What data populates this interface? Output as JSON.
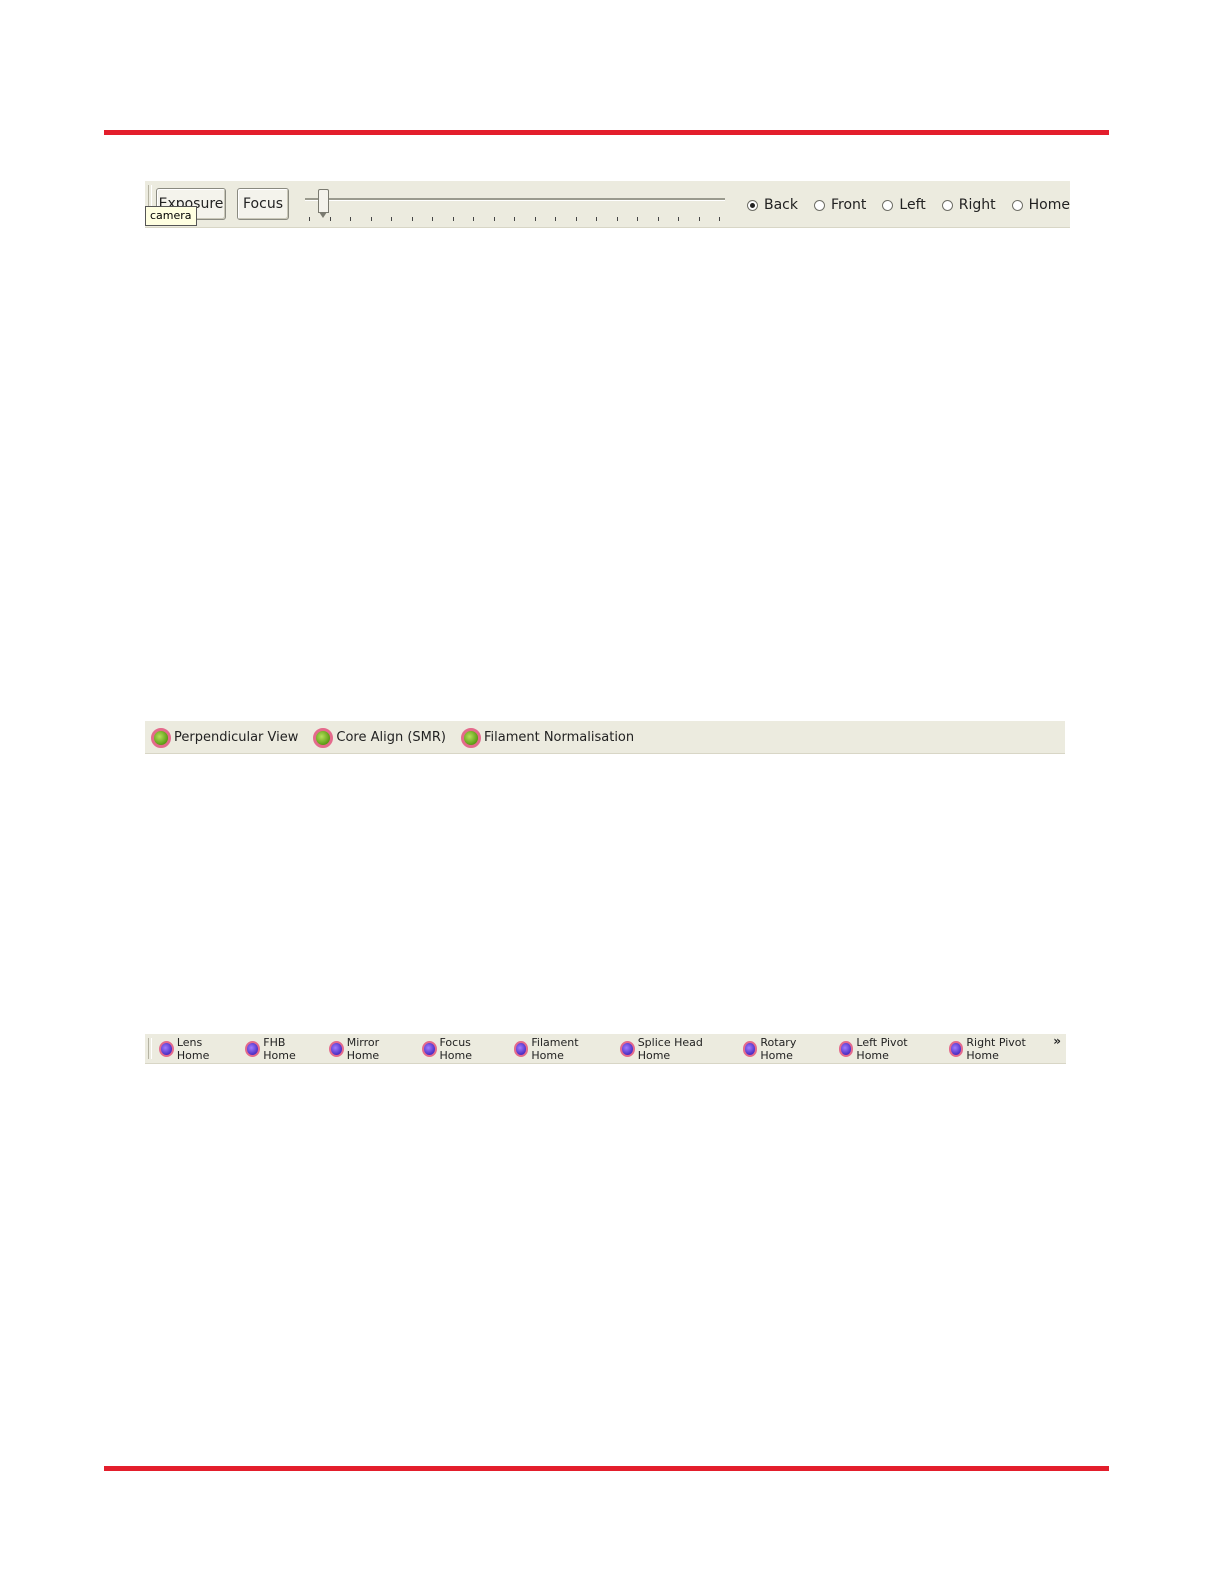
{
  "camera_toolbar": {
    "exposure_label": "Exposure",
    "focus_label": "Focus",
    "tooltip": "camera",
    "view_options": [
      {
        "label": "Back",
        "checked": true
      },
      {
        "label": "Front",
        "checked": false
      },
      {
        "label": "Left",
        "checked": false
      },
      {
        "label": "Right",
        "checked": false
      },
      {
        "label": "Home",
        "checked": false
      }
    ]
  },
  "algorithm_toolbar": {
    "items": [
      {
        "label": "Perpendicular View",
        "led": "green"
      },
      {
        "label": "Core Align (SMR)",
        "led": "green"
      },
      {
        "label": "Filament Normalisation",
        "led": "green"
      }
    ]
  },
  "home_toolbar": {
    "items": [
      {
        "label": "Lens Home",
        "led": "blue"
      },
      {
        "label": "FHB Home",
        "led": "blue"
      },
      {
        "label": "Mirror Home",
        "led": "blue"
      },
      {
        "label": "Focus Home",
        "led": "blue"
      },
      {
        "label": "Filament Home",
        "led": "blue"
      },
      {
        "label": "Splice Head Home",
        "led": "blue"
      },
      {
        "label": "Rotary Home",
        "led": "blue"
      },
      {
        "label": "Left Pivot Home",
        "led": "blue"
      },
      {
        "label": "Right Pivot Home",
        "led": "blue"
      }
    ],
    "overflow_glyph": "»"
  },
  "colors": {
    "rule": "#e31e2c",
    "toolbar_bg": "#ecebdf",
    "led_green": "#7ac02a",
    "led_blue": "#6a45e6",
    "led_ring": "#e46a8c"
  }
}
